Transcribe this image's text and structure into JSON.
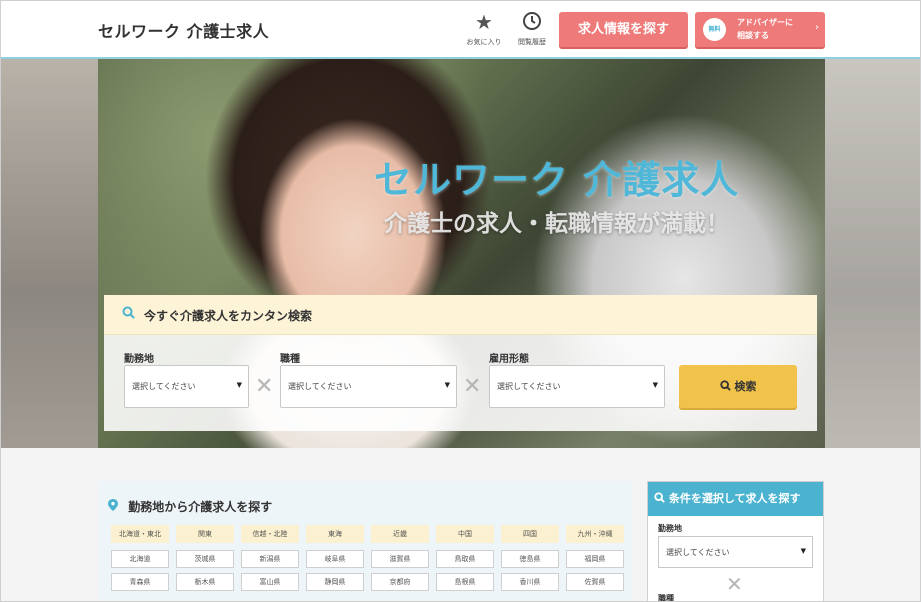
{
  "header": {
    "logo": "セルワーク 介護士求人",
    "favorites": {
      "label": "お気に入り",
      "icon": "star-icon"
    },
    "history": {
      "label": "閲覧履歴",
      "icon": "clock-icon"
    },
    "search_button": "求人情報を探す",
    "advisor_button": {
      "badge": "無料",
      "line1": "アドバイザーに",
      "line2": "相談する"
    }
  },
  "hero": {
    "title": "セルワーク 介護求人",
    "subtitle": "介護士の求人・転職情報が満載！"
  },
  "search": {
    "heading": "今すぐ介護求人をカンタン検索",
    "location": {
      "label": "勤務地",
      "value": "選択してください"
    },
    "job_type": {
      "label": "職種",
      "value": "選択してください"
    },
    "employment": {
      "label": "雇用形態",
      "value": "選択してください"
    },
    "submit": "検索"
  },
  "area_search": {
    "heading": "勤務地から介護求人を探す",
    "regions": [
      "北海道・東北",
      "関東",
      "信越・北陸",
      "東海",
      "近畿",
      "中国",
      "四国",
      "九州・沖縄"
    ],
    "row1": [
      "北海道",
      "茨城県",
      "新潟県",
      "岐阜県",
      "滋賀県",
      "鳥取県",
      "徳島県",
      "福岡県"
    ],
    "row2": [
      "青森県",
      "栃木県",
      "富山県",
      "静岡県",
      "京都府",
      "島根県",
      "香川県",
      "佐賀県"
    ]
  },
  "side_search": {
    "heading": "条件を選択して求人を探す",
    "location_label": "勤務地",
    "location_value": "選択してください",
    "job_type_label": "職種"
  },
  "colors": {
    "accent": "#4bb3d0",
    "cta": "#ef7a7a",
    "search": "#f2c34b"
  }
}
